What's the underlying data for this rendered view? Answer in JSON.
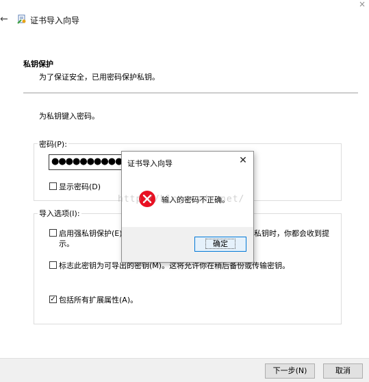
{
  "window": {
    "close_glyph": "×",
    "back_glyph": "←",
    "title": "证书导入向导"
  },
  "section": {
    "title": "私钥保护",
    "description": "为了保证安全，已用密码保护私钥。"
  },
  "prompt": "为私钥键入密码。",
  "password": {
    "group_label": "密码(P):",
    "value": "●●●●●●●●●●",
    "show_password_label": "显示密码(D)",
    "show_password_checked": false
  },
  "import_options": {
    "group_label": "导入选项(I):",
    "strong_protection": {
      "checked": false,
      "label_line1": "启用强私钥保护(E)",
      "label_line1_tail": "私钥时，你都会收到提",
      "label_line2": "示。"
    },
    "exportable": {
      "checked": false,
      "label": "标志此密钥为可导出的密钥(M)。这将允许你在稍后备份或传输密钥。"
    },
    "extended_props": {
      "checked": true,
      "check_glyph": "✓",
      "label": "包括所有扩展属性(A)。"
    }
  },
  "footer": {
    "next_label": "下一步(N)",
    "cancel_label": "取消"
  },
  "dialog": {
    "title": "证书导入向导",
    "close_glyph": "✕",
    "icon": "error-icon",
    "message": "输入的密码不正确。",
    "ok_label": "确定"
  },
  "watermark": "http://blog.csdn.net/",
  "colors": {
    "error_red": "#e81123",
    "focus_blue": "#0078d7"
  }
}
